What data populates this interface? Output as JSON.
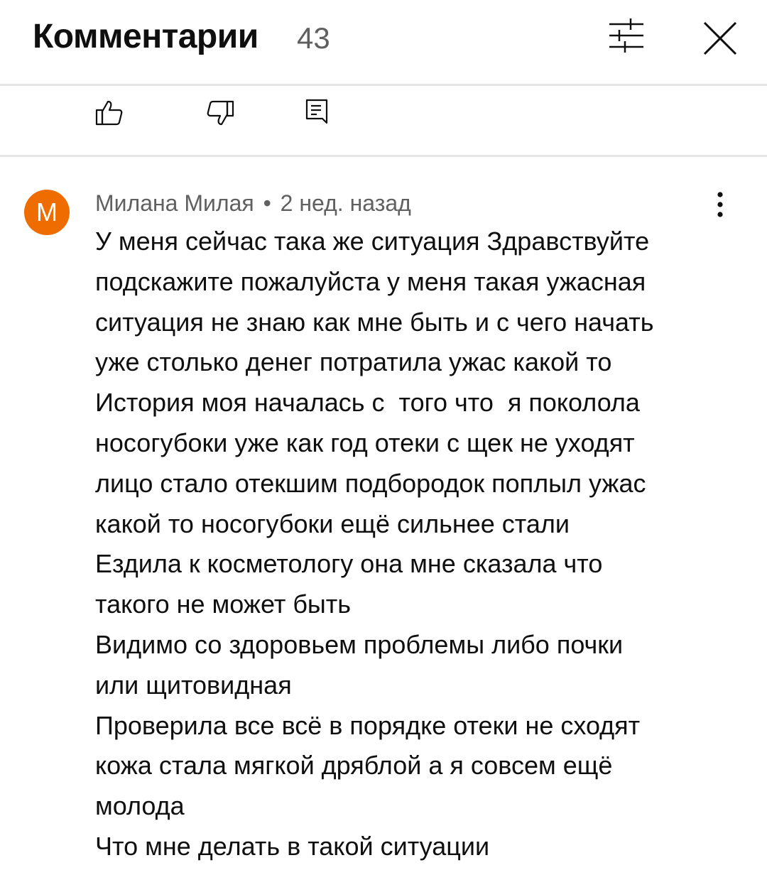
{
  "header": {
    "title": "Комментарии",
    "count": "43",
    "filter_icon": "sliders-icon",
    "close_icon": "close-icon"
  },
  "actions": {
    "like_icon": "thumbs-up-icon",
    "dislike_icon": "thumbs-down-icon",
    "reply_icon": "reply-comment-icon"
  },
  "comment": {
    "avatar_letter": "М",
    "avatar_color": "#ef6c00",
    "author": "Милана Милая",
    "separator": "•",
    "time": "2 нед. назад",
    "menu_icon": "more-vertical-icon",
    "text": "У меня сейчас така же ситуация Здравствуйте\nподскажите пожалуйста у меня такая ужасная\nситуация не знаю как мне быть и с чего начать\nуже столько денег потратила ужас какой то\nИстория моя началась с  того что  я поколола\nносогубоки уже как год отеки с щек не уходят\nлицо стало отекшим подбородок поплыл ужас\nкакой то носогубоки ещё сильнее стали\nЕздила к косметологу она мне сказала что\nтакого не может быть\nВидимо со здоровьем проблемы либо почки\nили щитовидная\nПроверила все всё в порядке отеки не сходят\nкожа стала мягкой дряблой а я совсем ещё\nмолода\nЧто мне делать в такой ситуации"
  }
}
